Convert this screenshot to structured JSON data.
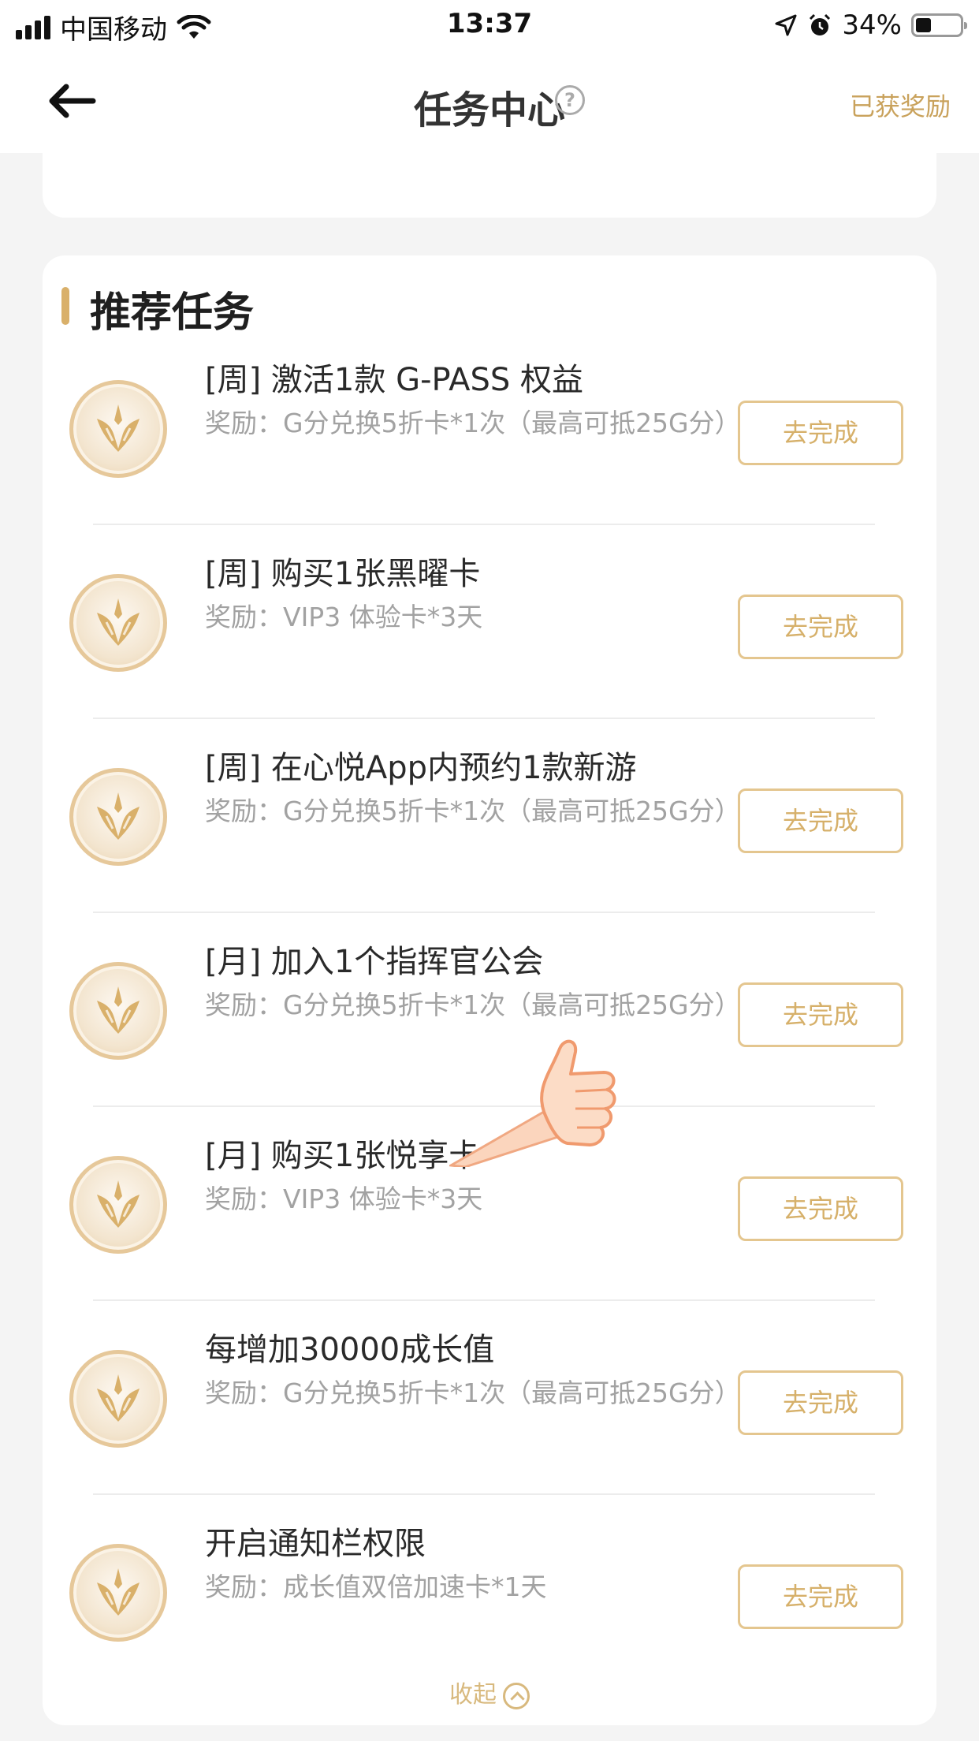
{
  "status_bar": {
    "carrier": "中国移动",
    "time": "13:37",
    "battery_percent": "34%",
    "battery_level": 0.34
  },
  "nav": {
    "title": "任务中心",
    "help_glyph": "?",
    "rewards_link": "已获奖励"
  },
  "section": {
    "title": "推荐任务"
  },
  "tasks": [
    {
      "name": "[周] 激活1款 G-PASS 权益",
      "reward": "奖励：G分兑换5折卡*1次（最高可抵25G分）",
      "button": "去完成"
    },
    {
      "name": "[周] 购买1张黑曜卡",
      "reward": "奖励：VIP3 体验卡*3天",
      "button": "去完成"
    },
    {
      "name": "[周] 在心悦App内预约1款新游",
      "reward": "奖励：G分兑换5折卡*1次（最高可抵25G分）",
      "button": "去完成"
    },
    {
      "name": "[月] 加入1个指挥官公会",
      "reward": "奖励：G分兑换5折卡*1次（最高可抵25G分）",
      "button": "去完成"
    },
    {
      "name": "[月] 购买1张悦享卡",
      "reward": "奖励：VIP3 体验卡*3天",
      "button": "去完成"
    },
    {
      "name": "每增加30000成长值",
      "reward": "奖励：G分兑换5折卡*1次（最高可抵25G分）",
      "button": "去完成"
    },
    {
      "name": "开启通知栏权限",
      "reward": "奖励：成长值双倍加速卡*1天",
      "button": "去完成"
    }
  ],
  "collapse_label": "收起",
  "colors": {
    "accent": "#d6b06a",
    "section_marker": "#d9b06a",
    "background": "#f4f4f4"
  },
  "icons": [
    "signal-icon",
    "wifi-icon",
    "location-icon",
    "alarm-icon",
    "battery-icon",
    "back-arrow-icon",
    "help-icon",
    "medal-icon",
    "chevron-up-icon",
    "thumbs-up-icon"
  ]
}
